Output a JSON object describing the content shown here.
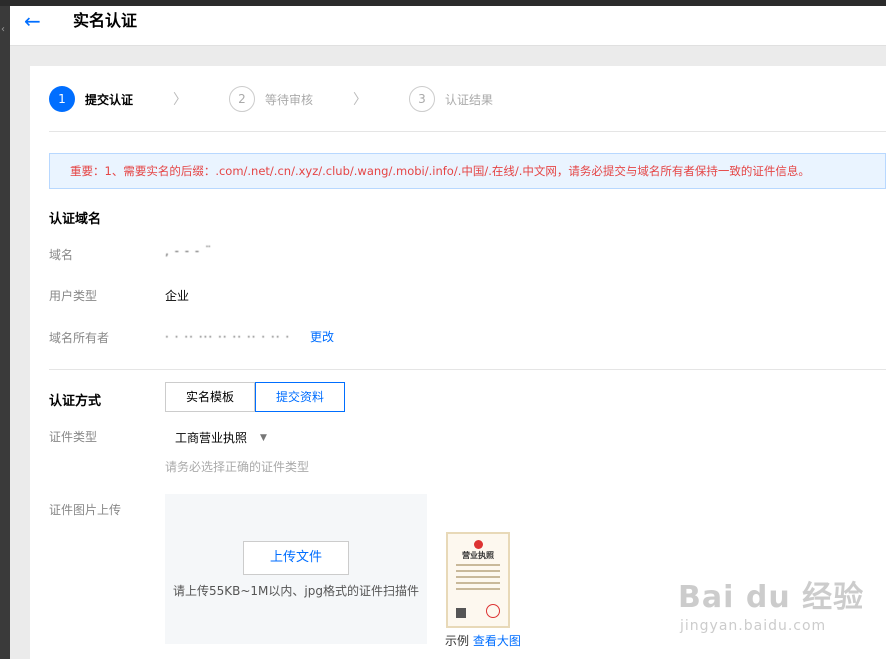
{
  "header": {
    "title": "实名认证",
    "back_icon": "←"
  },
  "steps": [
    {
      "num": "1",
      "label": "提交认证",
      "state": "active"
    },
    {
      "num": "2",
      "label": "等待审核",
      "state": "inactive"
    },
    {
      "num": "3",
      "label": "认证结果",
      "state": "inactive"
    }
  ],
  "notice": "重要：1、需要实名的后缀：.com/.net/.cn/.xyz/.club/.wang/.mobi/.info/.中国/.在线/.中文网，请务必提交与域名所有者保持一致的证件信息。",
  "domain_section": {
    "title": "认证域名",
    "domain_label": "域名",
    "domain_value": ", - - -      ¨",
    "user_type_label": "用户类型",
    "user_type_value": "企业",
    "owner_label": "域名所有者",
    "owner_value": "· · ·· ··· ·· ·· ·· · ·· ·",
    "change_link": "更改"
  },
  "method_section": {
    "title": "认证方式",
    "tabs": [
      "实名模板",
      "提交资料"
    ],
    "cert_type_label": "证件类型",
    "cert_type_value": "工商营业执照",
    "cert_type_hint": "请务必选择正确的证件类型",
    "upload_label": "证件图片上传",
    "upload_button": "上传文件",
    "upload_tip": "请上传55KB~1M以内、jpg格式的证件扫描件",
    "sample_title": "营业执照",
    "sample_caption": "示例",
    "view_large": "查看大图"
  },
  "watermark": {
    "line1": "Bai du 经验",
    "line2": "jingyan.baidu.com"
  },
  "colors": {
    "accent": "#006eff",
    "notice_text": "#e54545",
    "notice_bg": "#eaf4ff"
  }
}
